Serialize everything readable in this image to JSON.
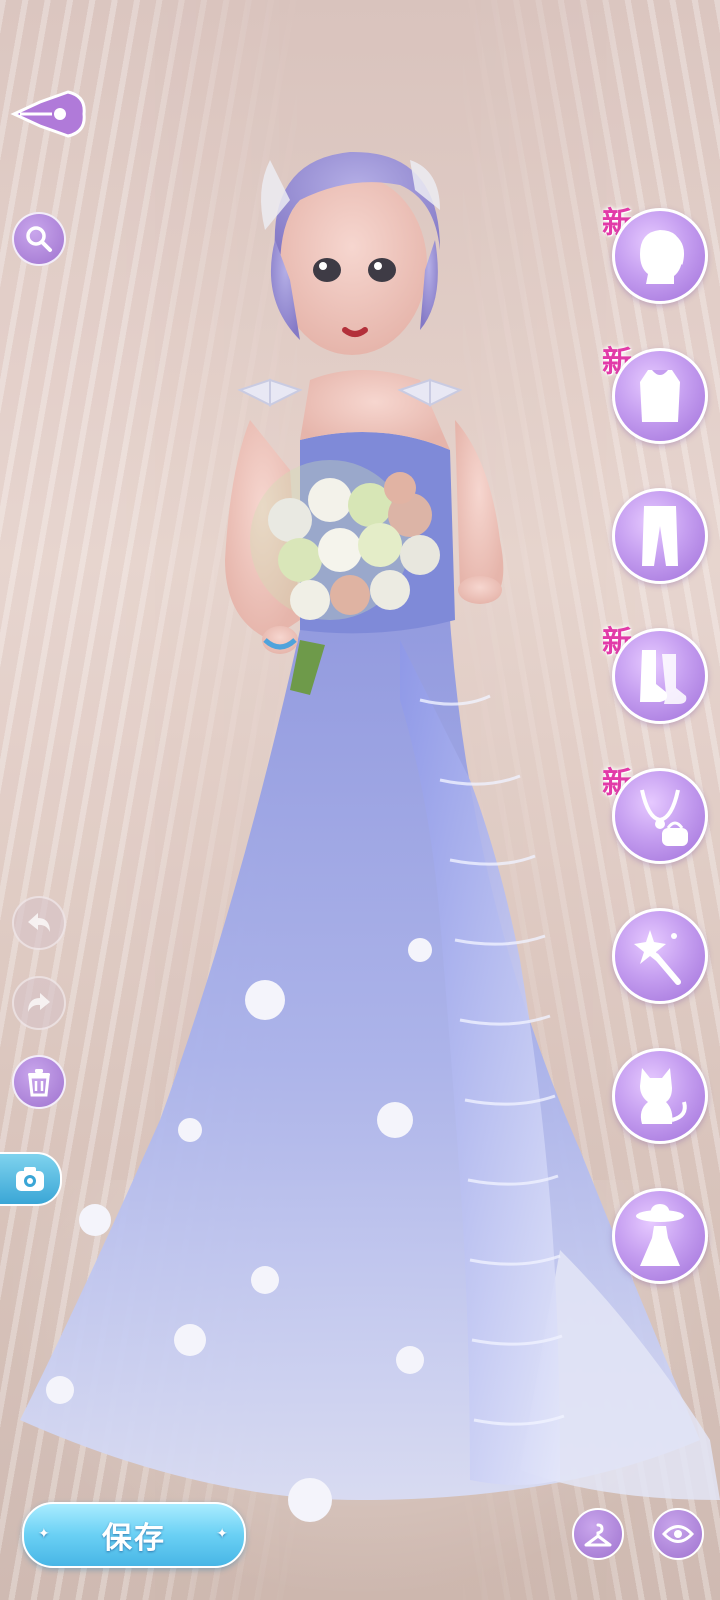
{
  "badges": {
    "new": "新"
  },
  "actions": {
    "save_label": "保存"
  },
  "categories": [
    {
      "name": "hair",
      "icon": "hair-silhouette-icon",
      "new": true
    },
    {
      "name": "top",
      "icon": "top-clothing-icon",
      "new": true
    },
    {
      "name": "bottom",
      "icon": "pants-icon",
      "new": false
    },
    {
      "name": "shoes",
      "icon": "socks-icon",
      "new": true
    },
    {
      "name": "accessories",
      "icon": "necklace-bag-icon",
      "new": true
    },
    {
      "name": "effects",
      "icon": "magic-wand-icon",
      "new": false
    },
    {
      "name": "pet",
      "icon": "cat-icon",
      "new": false
    },
    {
      "name": "outfit",
      "icon": "hat-dress-icon",
      "new": false
    }
  ],
  "colors": {
    "accent_purple": "#a57ad8",
    "save_blue": "#5cc4ee",
    "new_badge": "#e23aa8",
    "gown_lavender": "#a9b2ea"
  }
}
